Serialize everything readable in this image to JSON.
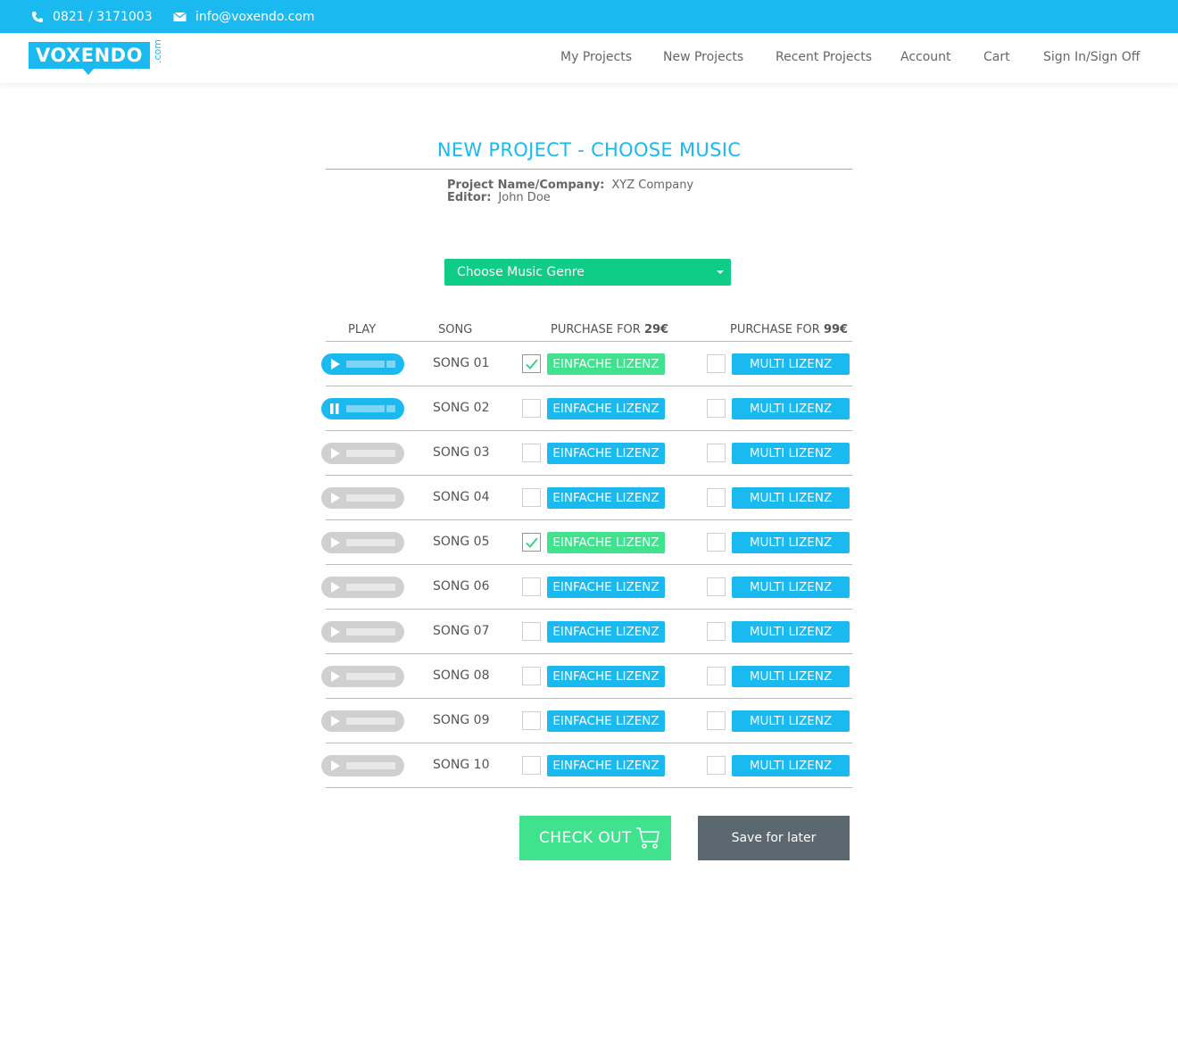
{
  "topbar": {
    "phone": "0821 / 3171003",
    "email": "info@voxendo.com"
  },
  "brand": {
    "name": "VOXENDO",
    "suffix": ".com",
    "color": "#1ab9ef"
  },
  "nav": [
    "My Projects",
    "New Projects",
    "Recent Projects",
    "Account",
    "Cart",
    "Sign In/Sign Off"
  ],
  "page": {
    "title": "NEW PROJECT - CHOOSE MUSIC",
    "project_label": "Project Name/Company:",
    "project_value": "XYZ Company",
    "editor_label": "Editor:",
    "editor_value": "John Doe"
  },
  "genre": {
    "label": "Choose Music Genre",
    "color": "#0fcc87"
  },
  "table": {
    "col_play": "PLAY",
    "col_song": "SONG",
    "col_single_prefix": "PURCHASE FOR ",
    "col_single_price": "29€",
    "col_multi_prefix": "PURCHASE FOR ",
    "col_multi_price": "99€",
    "single_label": "EINFACHE LIZENZ",
    "multi_label": "MULTI LIZENZ",
    "rows": [
      {
        "song": "SONG 01",
        "player": "play-active",
        "single": true,
        "multi": false
      },
      {
        "song": "SONG 02",
        "player": "pause-active",
        "single": false,
        "multi": false
      },
      {
        "song": "SONG 03",
        "player": "idle",
        "single": false,
        "multi": false
      },
      {
        "song": "SONG 04",
        "player": "idle",
        "single": false,
        "multi": false
      },
      {
        "song": "SONG 05",
        "player": "idle",
        "single": true,
        "multi": false
      },
      {
        "song": "SONG 06",
        "player": "idle",
        "single": false,
        "multi": false
      },
      {
        "song": "SONG 07",
        "player": "idle",
        "single": false,
        "multi": false
      },
      {
        "song": "SONG 08",
        "player": "idle",
        "single": false,
        "multi": false
      },
      {
        "song": "SONG 09",
        "player": "idle",
        "single": false,
        "multi": false
      },
      {
        "song": "SONG 10",
        "player": "idle",
        "single": false,
        "multi": false
      }
    ]
  },
  "actions": {
    "checkout": "CHECK OUT",
    "save": "Save for later"
  },
  "colors": {
    "primary": "#1ab9ef",
    "green": "#41e28e",
    "gray_button": "#5b6870"
  }
}
